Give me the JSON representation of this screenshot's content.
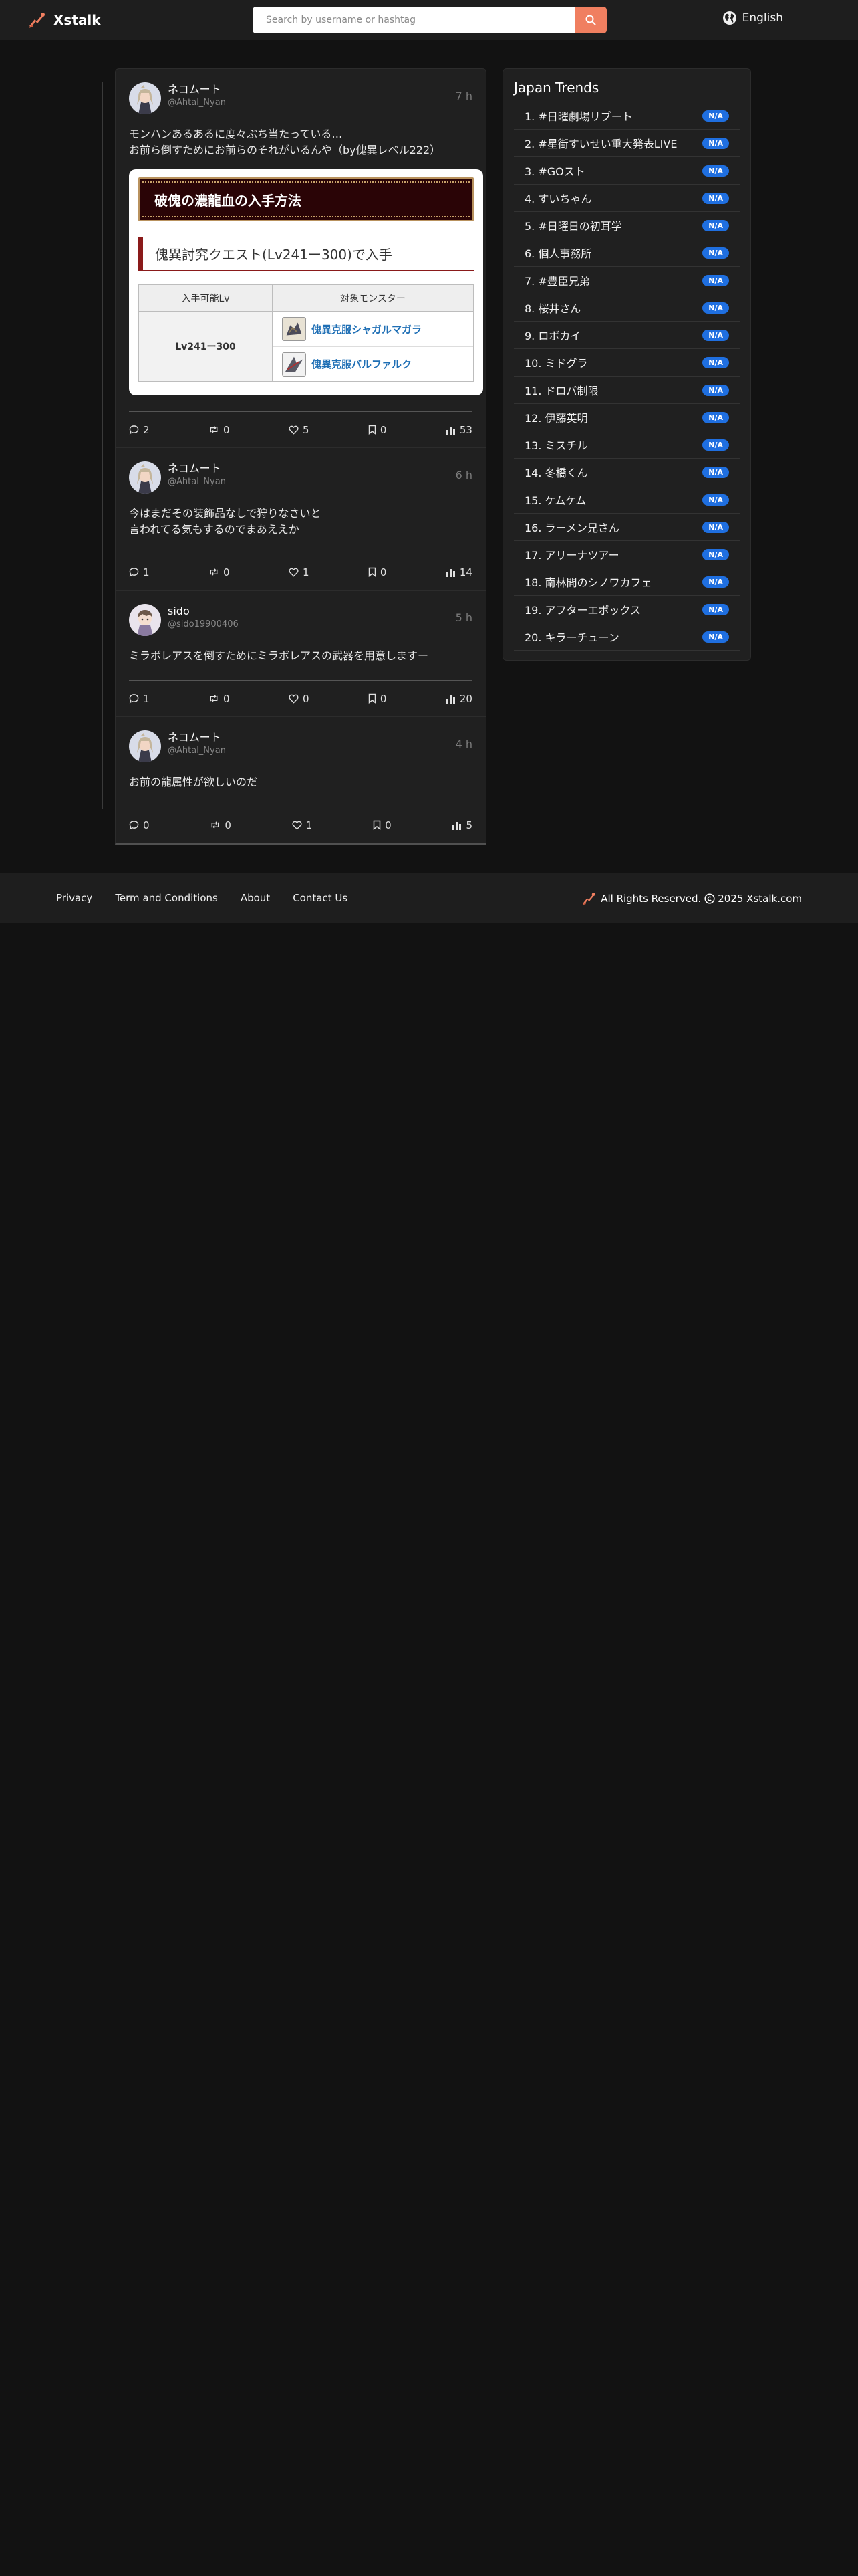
{
  "header": {
    "brand": "Xstalk",
    "search_placeholder": "Search by username or hashtag",
    "language": "English"
  },
  "posts": [
    {
      "name": "ネコムート",
      "handle": "@Ahtal_Nyan",
      "time": "7 h",
      "text": "モンハンあるあるに度々ぶち当たっている…\nお前ら倒すためにお前らのそれがいるんや（by傀異レベル222）",
      "embed": {
        "title": "破傀の濃龍血の入手方法",
        "subtitle": "傀異討究クエスト(Lv241ー300)で入手",
        "col_level": "入手可能Lv",
        "col_monster": "対象モンスター",
        "level_value": "Lv241ー300",
        "monsters": [
          "傀異克服シャガルマガラ",
          "傀異克服バルファルク"
        ]
      },
      "replies": "2",
      "reposts": "0",
      "likes": "5",
      "bookmarks": "0",
      "views": "53"
    },
    {
      "name": "ネコムート",
      "handle": "@Ahtal_Nyan",
      "time": "6 h",
      "text": "今はまだその装飾品なしで狩りなさいと\n言われてる気もするのでまあええか",
      "replies": "1",
      "reposts": "0",
      "likes": "1",
      "bookmarks": "0",
      "views": "14"
    },
    {
      "name": "sido",
      "handle": "@sido19900406",
      "time": "5 h",
      "text": "ミラボレアスを倒すためにミラボレアスの武器を用意しますー",
      "replies": "1",
      "reposts": "0",
      "likes": "0",
      "bookmarks": "0",
      "views": "20"
    },
    {
      "name": "ネコムート",
      "handle": "@Ahtal_Nyan",
      "time": "4 h",
      "text": "お前の龍属性が欲しいのだ",
      "replies": "0",
      "reposts": "0",
      "likes": "1",
      "bookmarks": "0",
      "views": "5"
    }
  ],
  "trends": {
    "title": "Japan Trends",
    "badge": "N/A",
    "items": [
      "1. #日曜劇場リブート",
      "2. #星街すいせい重大発表LIVE",
      "3. #GOスト",
      "4. すいちゃん",
      "5. #日曜日の初耳学",
      "6. 個人事務所",
      "7. #豊臣兄弟",
      "8. 桜井さん",
      "9. ロボカイ",
      "10. ミドグラ",
      "11. ドロバ制限",
      "12. 伊藤英明",
      "13. ミスチル",
      "14. 冬橋くん",
      "15. ケムケム",
      "16. ラーメン兄さん",
      "17. アリーナツアー",
      "18. 南林間のシノワカフェ",
      "19. アフターエポックス",
      "20. キラーチューン"
    ]
  },
  "footer": {
    "links": [
      "Privacy",
      "Term and Conditions",
      "About",
      "Contact Us"
    ],
    "rights": "All Rights Reserved.",
    "copyright": "2025 Xstalk.com"
  },
  "colors": {
    "accent": "#f07f60",
    "badge": "#1f6fe0",
    "background": "#121212",
    "panel": "#202020"
  }
}
